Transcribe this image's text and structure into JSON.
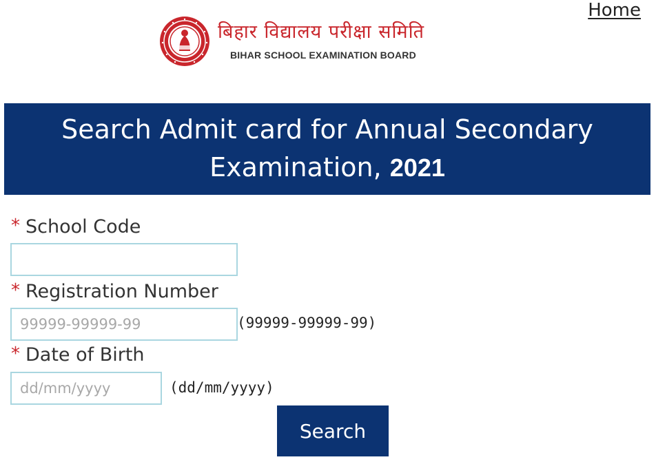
{
  "header": {
    "home_link": "Home",
    "org_name_hindi": "बिहार विद्यालय परीक्षा समिति",
    "org_name_english": "BIHAR SCHOOL EXAMINATION BOARD",
    "logo_icon": "bseb-seal-icon"
  },
  "banner": {
    "title_line1": "Search Admit card for Annual Secondary",
    "title_line2": "Examination,",
    "title_year": "2021"
  },
  "form": {
    "required_marker": "*",
    "school_code": {
      "label": "School Code",
      "value": "",
      "placeholder": ""
    },
    "registration_number": {
      "label": "Registration Number",
      "value": "",
      "placeholder": "99999-99999-99",
      "hint": "(99999-99999-99)"
    },
    "date_of_birth": {
      "label": "Date of Birth",
      "value": "",
      "placeholder": "dd/mm/yyyy",
      "hint": "(dd/mm/yyyy)"
    },
    "search_button": "Search"
  },
  "colors": {
    "banner_bg": "#0c3372",
    "button_bg": "#0c3372",
    "required_star": "#c9262c",
    "hindi_title": "#c9262c",
    "input_border": "#a9d6e0",
    "seal_red": "#c9262c"
  }
}
